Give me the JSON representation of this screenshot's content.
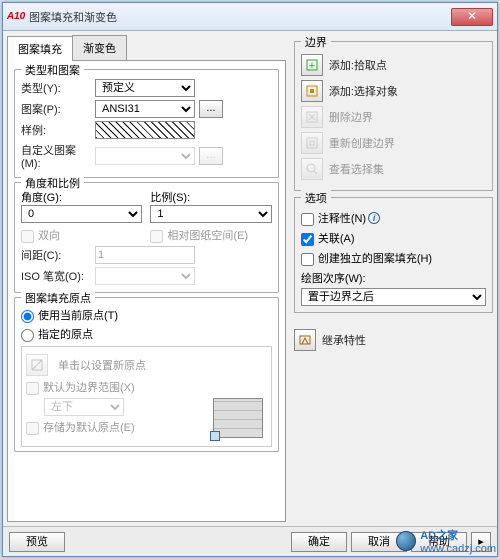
{
  "window": {
    "app_badge": "A10",
    "title": "图案填充和渐变色"
  },
  "tabs": {
    "hatch": "图案填充",
    "gradient": "渐变色"
  },
  "type_pattern": {
    "group": "类型和图案",
    "type_label": "类型(Y):",
    "type_value": "预定义",
    "pattern_label": "图案(P):",
    "pattern_value": "ANSI31",
    "sample_label": "样例:",
    "custom_label": "自定义图案(M):"
  },
  "angle_scale": {
    "group": "角度和比例",
    "angle_label": "角度(G):",
    "angle_value": "0",
    "scale_label": "比例(S):",
    "scale_value": "1",
    "double": "双向",
    "paper": "相对图纸空间(E)",
    "spacing_label": "间距(C):",
    "spacing_value": "1",
    "iso_label": "ISO 笔宽(O):"
  },
  "origin": {
    "group": "图案填充原点",
    "use_current": "使用当前原点(T)",
    "specify": "指定的原点",
    "click_set": "单击以设置新原点",
    "default_extent": "默认为边界范围(X)",
    "extent_value": "左下",
    "store": "存储为默认原点(E)"
  },
  "boundary": {
    "group": "边界",
    "add_pick": "添加:拾取点",
    "add_select": "添加:选择对象",
    "delete": "删除边界",
    "recreate": "重新创建边界",
    "view_sel": "查看选择集"
  },
  "options": {
    "group": "选项",
    "annotative": "注释性(N)",
    "associative": "关联(A)",
    "independent": "创建独立的图案填充(H)",
    "draw_order_label": "绘图次序(W):",
    "draw_order_value": "置于边界之后"
  },
  "inherit": "继承特性",
  "footer": {
    "preview": "预览",
    "ok": "确定",
    "cancel": "取消",
    "help": "帮助"
  },
  "watermark": {
    "brand": "AD之家",
    "url": "www.cadzj.com"
  }
}
